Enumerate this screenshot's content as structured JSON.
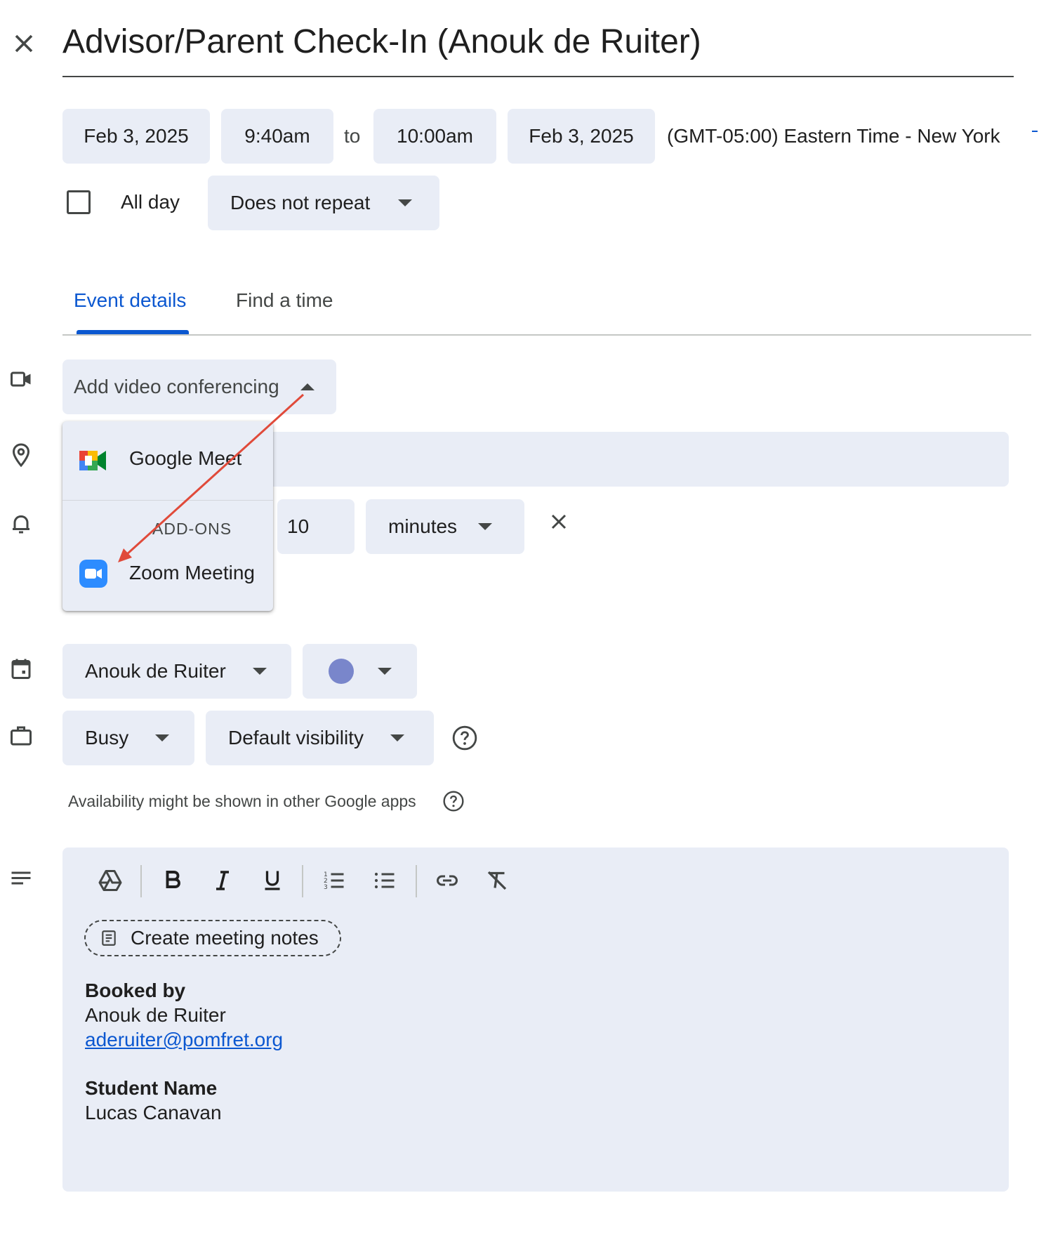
{
  "title": "Advisor/Parent Check-In (Anouk de Ruiter)",
  "datetime": {
    "start_date": "Feb 3, 2025",
    "start_time": "9:40am",
    "to_label": "to",
    "end_time": "10:00am",
    "end_date": "Feb 3, 2025",
    "timezone": "(GMT-05:00) Eastern Time - New York"
  },
  "allday": {
    "label": "All day",
    "checked": false
  },
  "repeat": {
    "value": "Does not repeat"
  },
  "tabs": [
    {
      "label": "Event details",
      "active": true
    },
    {
      "label": "Find a time",
      "active": false
    }
  ],
  "video": {
    "label": "Add video conferencing"
  },
  "dropdown": {
    "google_meet": "Google Meet",
    "addons_header": "ADD-ONS",
    "zoom": "Zoom Meeting"
  },
  "notification": {
    "value": "10",
    "unit": "minutes"
  },
  "calendar": {
    "owner": "Anouk de Ruiter",
    "color": "#7986cb"
  },
  "availability": {
    "status": "Busy",
    "visibility": "Default visibility",
    "note": "Availability might be shown in other Google apps"
  },
  "description": {
    "create_notes": "Create meeting notes",
    "booked_by_heading": "Booked by",
    "booked_by_name": "Anouk de Ruiter",
    "booked_by_email": "aderuiter@pomfret.org",
    "student_heading": "Student Name",
    "student_name": "Lucas Canavan"
  },
  "colors": {
    "accent": "#0b57d0",
    "chip_bg": "#e9edf6",
    "arrow": "#e04a3a"
  }
}
